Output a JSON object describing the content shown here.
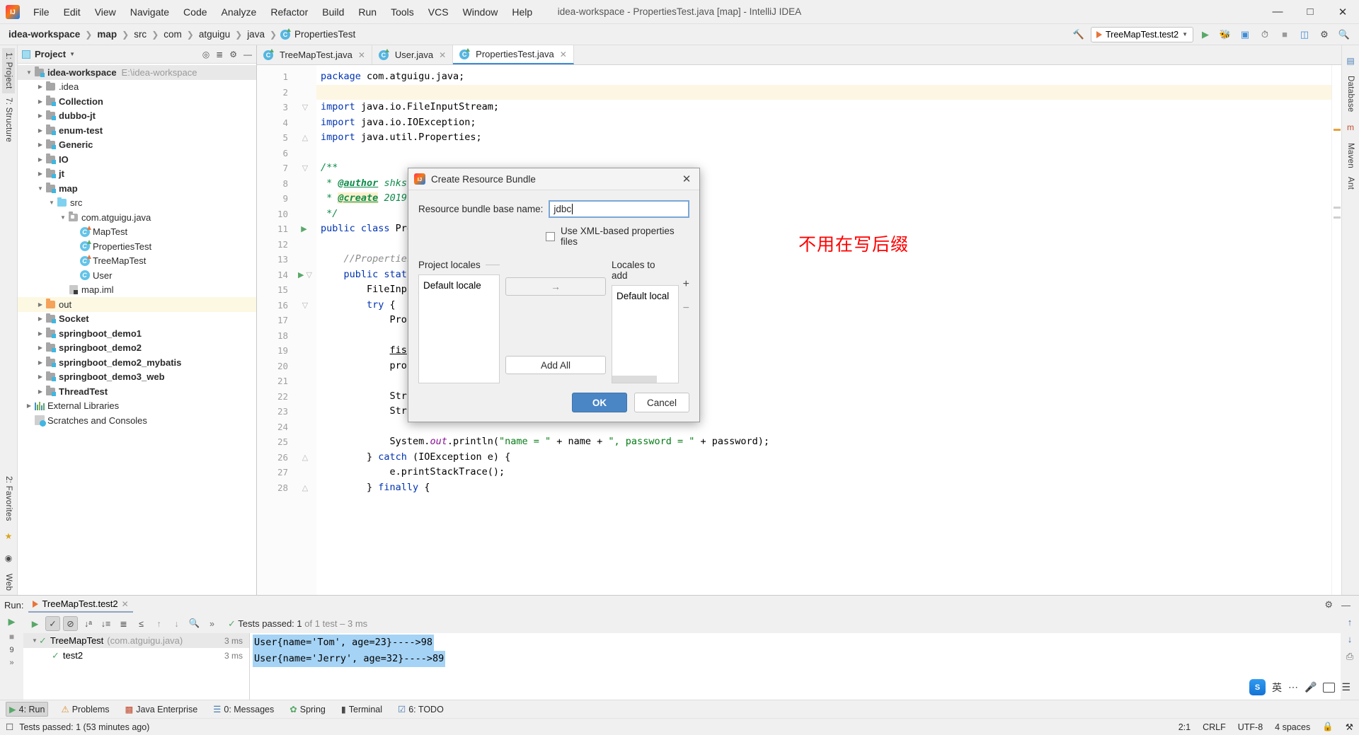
{
  "window": {
    "title": "idea-workspace - PropertiesTest.java [map] - IntelliJ IDEA",
    "minimize": "—",
    "maximize": "□",
    "close": "✕"
  },
  "menubar": [
    {
      "label": "File"
    },
    {
      "label": "Edit"
    },
    {
      "label": "View"
    },
    {
      "label": "Navigate"
    },
    {
      "label": "Code"
    },
    {
      "label": "Analyze"
    },
    {
      "label": "Refactor"
    },
    {
      "label": "Build"
    },
    {
      "label": "Run"
    },
    {
      "label": "Tools"
    },
    {
      "label": "VCS"
    },
    {
      "label": "Window"
    },
    {
      "label": "Help"
    }
  ],
  "breadcrumb": {
    "items": [
      "idea-workspace",
      "map",
      "src",
      "com",
      "atguigu",
      "java",
      "PropertiesTest"
    ]
  },
  "nav_right": {
    "run_config": "TreeMapTest.test2",
    "icons": [
      "hammer-icon",
      "run-icon",
      "debug-icon",
      "coverage-icon",
      "profile-icon",
      "stop-icon",
      "layout-icon",
      "settings-icon",
      "search-icon"
    ]
  },
  "left_strip": {
    "tabs": [
      "1: Project",
      "7: Structure"
    ],
    "bottom": [
      "2: Favorites",
      "Web"
    ]
  },
  "right_strip": {
    "tabs": [
      "Database",
      "Maven",
      "Ant"
    ]
  },
  "project_panel": {
    "title": "Project",
    "tools": [
      "target-icon",
      "collapse-icon",
      "gear-icon",
      "hide-icon"
    ],
    "tree": [
      {
        "indent": 0,
        "arrow": "open",
        "icon": "module-folder",
        "label": "idea-workspace",
        "bold": true,
        "path": "E:\\idea-workspace",
        "sel": "grey"
      },
      {
        "indent": 1,
        "arrow": "closed",
        "icon": "folder",
        "label": ".idea",
        "bold": false
      },
      {
        "indent": 1,
        "arrow": "closed",
        "icon": "module-folder",
        "label": "Collection",
        "bold": true
      },
      {
        "indent": 1,
        "arrow": "closed",
        "icon": "module-folder",
        "label": "dubbo-jt",
        "bold": true
      },
      {
        "indent": 1,
        "arrow": "closed",
        "icon": "module-folder",
        "label": "enum-test",
        "bold": true
      },
      {
        "indent": 1,
        "arrow": "closed",
        "icon": "module-folder",
        "label": "Generic",
        "bold": true
      },
      {
        "indent": 1,
        "arrow": "closed",
        "icon": "module-folder",
        "label": "IO",
        "bold": true
      },
      {
        "indent": 1,
        "arrow": "closed",
        "icon": "module-folder",
        "label": "jt",
        "bold": true
      },
      {
        "indent": 1,
        "arrow": "open",
        "icon": "module-folder",
        "label": "map",
        "bold": true
      },
      {
        "indent": 2,
        "arrow": "open",
        "icon": "source-folder",
        "label": "src",
        "bold": false
      },
      {
        "indent": 3,
        "arrow": "open",
        "icon": "package",
        "label": "com.atguigu.java",
        "bold": false
      },
      {
        "indent": 4,
        "arrow": "none",
        "icon": "class-runnable-orange",
        "label": "MapTest",
        "bold": false
      },
      {
        "indent": 4,
        "arrow": "none",
        "icon": "class-runnable-green",
        "label": "PropertiesTest",
        "bold": false
      },
      {
        "indent": 4,
        "arrow": "none",
        "icon": "class-runnable-orange",
        "label": "TreeMapTest",
        "bold": false
      },
      {
        "indent": 4,
        "arrow": "none",
        "icon": "class",
        "label": "User",
        "bold": false
      },
      {
        "indent": 3,
        "arrow": "none",
        "icon": "iml",
        "label": "map.iml",
        "bold": false
      },
      {
        "indent": 1,
        "arrow": "closed",
        "icon": "out-folder",
        "label": "out",
        "bold": false,
        "sel": "yellow"
      },
      {
        "indent": 1,
        "arrow": "closed",
        "icon": "module-folder",
        "label": "Socket",
        "bold": true
      },
      {
        "indent": 1,
        "arrow": "closed",
        "icon": "module-folder",
        "label": "springboot_demo1",
        "bold": true
      },
      {
        "indent": 1,
        "arrow": "closed",
        "icon": "module-folder",
        "label": "springboot_demo2",
        "bold": true
      },
      {
        "indent": 1,
        "arrow": "closed",
        "icon": "module-folder",
        "label": "springboot_demo2_mybatis",
        "bold": true
      },
      {
        "indent": 1,
        "arrow": "closed",
        "icon": "module-folder",
        "label": "springboot_demo3_web",
        "bold": true
      },
      {
        "indent": 1,
        "arrow": "closed",
        "icon": "module-folder",
        "label": "ThreadTest",
        "bold": true
      },
      {
        "indent": 0,
        "arrow": "closed",
        "icon": "libraries",
        "label": "External Libraries",
        "bold": false
      },
      {
        "indent": 0,
        "arrow": "none",
        "icon": "scratches",
        "label": "Scratches and Consoles",
        "bold": false
      }
    ]
  },
  "editor": {
    "tabs": [
      {
        "label": "TreeMapTest.java",
        "active": false
      },
      {
        "label": "User.java",
        "active": false
      },
      {
        "label": "PropertiesTest.java",
        "active": true
      }
    ],
    "lines": [
      {
        "n": 1,
        "html": "<span class=\"kw\">package</span> com.atguigu.java;"
      },
      {
        "n": 2,
        "html": "",
        "hl": true
      },
      {
        "n": 3,
        "html": "<span class=\"kw\">import</span> java.io.FileInputStream;",
        "fold": "open"
      },
      {
        "n": 4,
        "html": "<span class=\"kw\">import</span> java.io.IOException;"
      },
      {
        "n": 5,
        "html": "<span class=\"kw\">import</span> java.util.Properties;",
        "fold": "end"
      },
      {
        "n": 6,
        "html": ""
      },
      {
        "n": 7,
        "html": "<span class=\"jdoc\">/**</span>",
        "fold": "open",
        "bookmark": true
      },
      {
        "n": 8,
        "html": " <span class=\"jdoc\">* </span><span class=\"jdoc-tag\">@author</span><span class=\"jdoc\"> shkstart</span>"
      },
      {
        "n": 9,
        "html": " <span class=\"jdoc\">* </span><span class=\"jdoc-tag hlw\">@create</span><span class=\"jdoc\"> 2019 下4</span>"
      },
      {
        "n": 10,
        "html": " <span class=\"jdoc\">*/</span>"
      },
      {
        "n": 11,
        "html": "<span class=\"kw\">public class</span> Proper",
        "run": true
      },
      {
        "n": 12,
        "html": ""
      },
      {
        "n": 13,
        "html": "    <span class=\"cmt\" style=\"font-style:italic\">//Properties:属</span>"
      },
      {
        "n": 14,
        "html": "    <span class=\"kw\">public static </span>",
        "run": true,
        "fold": "open"
      },
      {
        "n": 15,
        "html": "        FileInputS"
      },
      {
        "n": 16,
        "html": "        <span class=\"kw\">try</span> {",
        "fold": "open"
      },
      {
        "n": 17,
        "html": "            Propert"
      },
      {
        "n": 18,
        "html": ""
      },
      {
        "n": 19,
        "html": "            <span class=\"var\">fis</span> = <span class=\"kw\">n</span>"
      },
      {
        "n": 20,
        "html": "            pros.l"
      },
      {
        "n": 21,
        "html": ""
      },
      {
        "n": 22,
        "html": "            String"
      },
      {
        "n": 23,
        "html": "            String"
      },
      {
        "n": 24,
        "html": ""
      },
      {
        "n": 25,
        "html": "            System.<span class=\"stat\">out</span>.println(<span class=\"str\">\"name = \"</span> + name + <span class=\"str\">\", password = \"</span> + password);"
      },
      {
        "n": 26,
        "html": "        } <span class=\"kw\">catch</span> (IOException e) {",
        "fold": "end"
      },
      {
        "n": 27,
        "html": "            e.printStackTrace();"
      },
      {
        "n": 28,
        "html": "        } <span class=\"kw\">finally</span> {",
        "fold": "end"
      }
    ]
  },
  "dialog": {
    "title": "Create Resource Bundle",
    "close_icon": "close-icon",
    "base_name_label": "Resource bundle base name:",
    "base_name_value": "jdbc",
    "xml_checkbox_label": "Use XML-based properties files",
    "xml_checkbox_checked": false,
    "project_locales_label": "Project locales",
    "project_locales_items": [
      "Default locale"
    ],
    "locales_to_add_label": "Locales to add",
    "locales_to_add_items": [
      "Default local"
    ],
    "transfer_arrow": "→",
    "add_all_label": "Add All",
    "plus_label": "+",
    "minus_label": "−",
    "ok_label": "OK",
    "cancel_label": "Cancel"
  },
  "annotation": {
    "text": "不用在写后缀",
    "color": "#ff0000"
  },
  "run_panel": {
    "run_label": "Run:",
    "tab_label": "TreeMapTest.test2",
    "status_prefix": "Tests passed:",
    "status_count": "1",
    "status_suffix": "of 1 test – 3 ms",
    "toolbar_icons": [
      "rerun-icon",
      "show-passed-icon",
      "hide-ignored-icon",
      "sort-alpha-icon",
      "sort-duration-icon",
      "expand-all-icon",
      "collapse-all-icon",
      "prev-icon",
      "next-icon",
      "history-icon",
      "more-icon"
    ],
    "tree": [
      {
        "label": "TreeMapTest",
        "suffix": "(com.atguigu.java)",
        "time": "3 ms",
        "sel": true,
        "arrow": "open",
        "indent": 0
      },
      {
        "label": "test2",
        "suffix": "",
        "time": "3 ms",
        "sel": false,
        "arrow": "none",
        "indent": 1
      }
    ],
    "console": [
      "User{name='Tom', age=23}---->98",
      "User{name='Jerry', age=32}---->89"
    ],
    "left_badge": "9"
  },
  "tool_strip": [
    {
      "label": "4: Run",
      "icon": "run-icon",
      "sel": true
    },
    {
      "label": "Problems",
      "icon": "warning-icon",
      "sel": false
    },
    {
      "label": "Java Enterprise",
      "icon": "java-icon",
      "sel": false
    },
    {
      "label": "0: Messages",
      "icon": "message-icon",
      "sel": false
    },
    {
      "label": "Spring",
      "icon": "leaf-icon",
      "sel": false
    },
    {
      "label": "Terminal",
      "icon": "terminal-icon",
      "sel": false
    },
    {
      "label": "6: TODO",
      "icon": "todo-icon",
      "sel": false
    }
  ],
  "status_bar": {
    "message": "Tests passed: 1 (53 minutes ago)",
    "caret": "2:1",
    "line_sep": "CRLF",
    "encoding": "UTF-8",
    "indent": "4 spaces",
    "icons": [
      "lock-icon",
      "event-icon"
    ]
  },
  "ime": {
    "lang": "英",
    "items": [
      "ime-logo",
      "lang-label",
      "dots-icon",
      "mic-icon",
      "keyboard-icon",
      "menu-icon"
    ]
  }
}
